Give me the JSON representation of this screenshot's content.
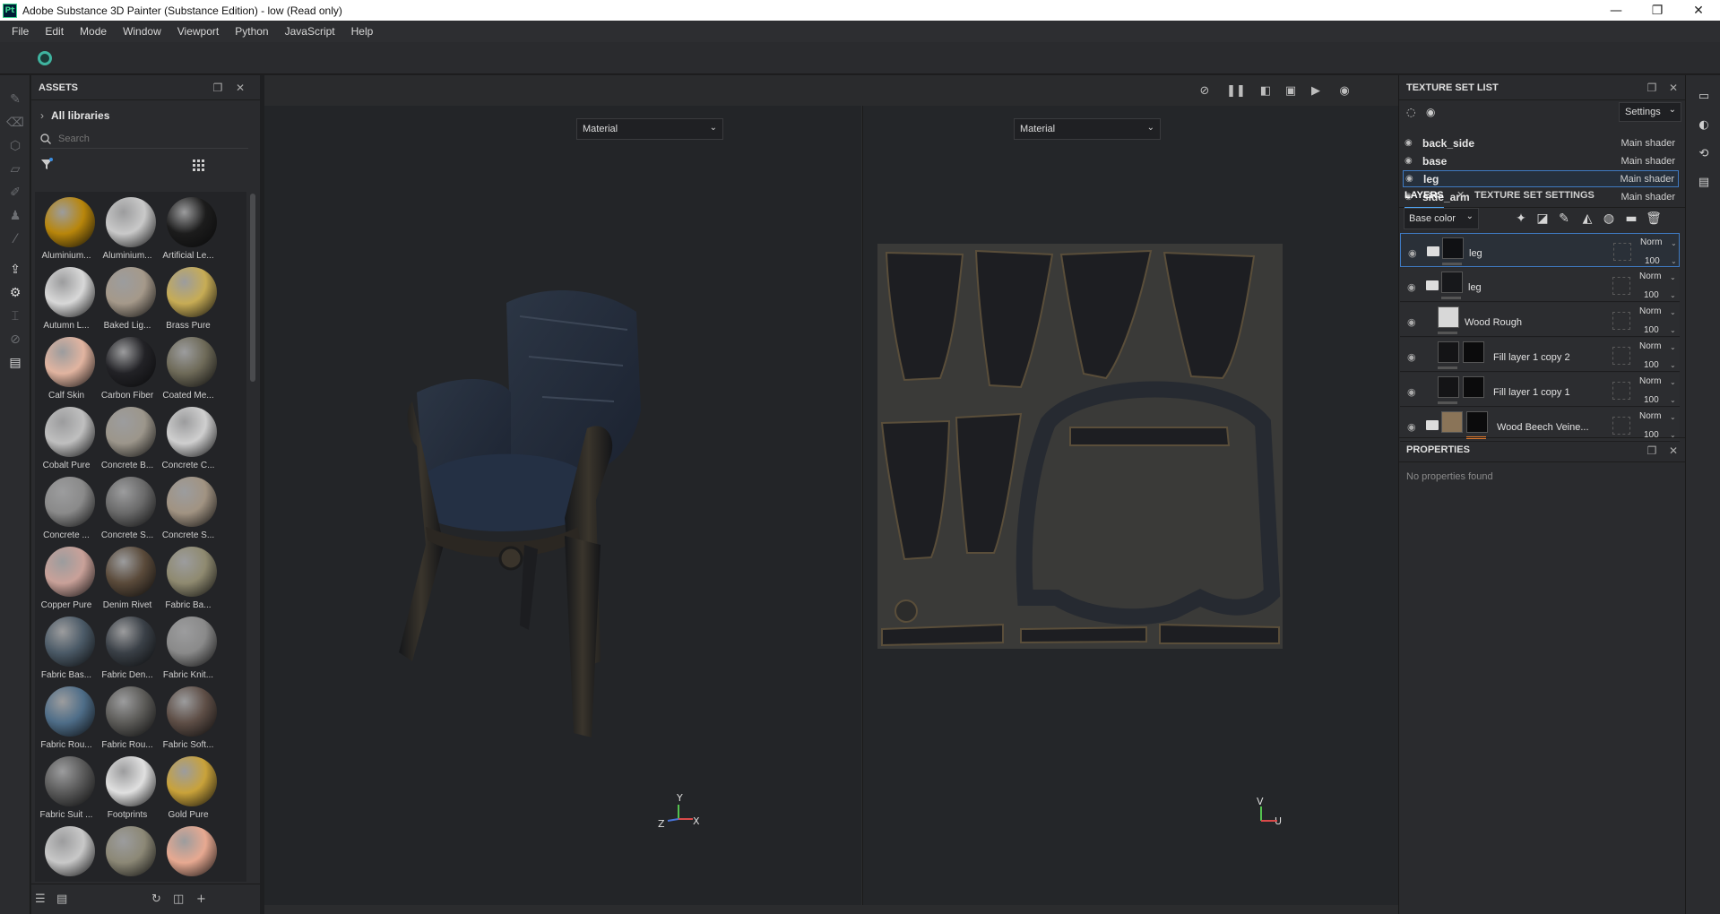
{
  "window": {
    "title": "Adobe Substance 3D Painter (Substance Edition) - low (Read only)",
    "app_badge": "Pt",
    "controls": [
      "—",
      "❐",
      "✕"
    ]
  },
  "menu": [
    "File",
    "Edit",
    "Mode",
    "Window",
    "Viewport",
    "Python",
    "JavaScript",
    "Help"
  ],
  "assets": {
    "title": "ASSETS",
    "libraries_label": "All libraries",
    "search_placeholder": "Search",
    "materials": [
      {
        "label": "Aluminium...",
        "color": "#b8860b"
      },
      {
        "label": "Aluminium...",
        "color": "#c9c9c9"
      },
      {
        "label": "Artificial Le...",
        "color": "#1c1c1c"
      },
      {
        "label": "Autumn L...",
        "color": "#d8d8d8"
      },
      {
        "label": "Baked Lig...",
        "color": "#a5998a"
      },
      {
        "label": "Brass Pure",
        "color": "#c7ac55"
      },
      {
        "label": "Calf Skin",
        "color": "#e1b4a0"
      },
      {
        "label": "Carbon Fiber",
        "color": "#222226"
      },
      {
        "label": "Coated Me...",
        "color": "#6e6a58"
      },
      {
        "label": "Cobalt Pure",
        "color": "#bfbfbf"
      },
      {
        "label": "Concrete B...",
        "color": "#9c968b"
      },
      {
        "label": "Concrete C...",
        "color": "#cfcfcf"
      },
      {
        "label": "Concrete ...",
        "color": "#8a8a8a"
      },
      {
        "label": "Concrete S...",
        "color": "#6a6a6a"
      },
      {
        "label": "Concrete S...",
        "color": "#a19382"
      },
      {
        "label": "Copper Pure",
        "color": "#c9a199"
      },
      {
        "label": "Denim Rivet",
        "color": "#5a4a3a"
      },
      {
        "label": "Fabric Ba...",
        "color": "#8f8a70"
      },
      {
        "label": "Fabric Bas...",
        "color": "#4b5a67"
      },
      {
        "label": "Fabric Den...",
        "color": "#3a4047"
      },
      {
        "label": "Fabric Knit...",
        "color": "#8a8a8a"
      },
      {
        "label": "Fabric Rou...",
        "color": "#4e6d88"
      },
      {
        "label": "Fabric Rou...",
        "color": "#5c5b58"
      },
      {
        "label": "Fabric Soft...",
        "color": "#5e4e46"
      },
      {
        "label": "Fabric Suit ...",
        "color": "#5a5a5a"
      },
      {
        "label": "Footprints",
        "color": "#e0e0e0"
      },
      {
        "label": "Gold Pure",
        "color": "#c9a23a"
      },
      {
        "label": "",
        "color": "#c8c8c8"
      },
      {
        "label": "",
        "color": "#8c8876"
      },
      {
        "label": "",
        "color": "#e7a991"
      }
    ]
  },
  "viewport": {
    "left_mode": "Material",
    "right_mode": "Material",
    "axes_3d": {
      "y": "Y",
      "z": "Z",
      "x": "X"
    },
    "axes_2d": {
      "v": "V",
      "u": "U"
    }
  },
  "texture_set_list": {
    "title": "TEXTURE SET LIST",
    "settings_label": "Settings",
    "items": [
      {
        "name": "back_side",
        "shader": "Main shader",
        "selected": false
      },
      {
        "name": "base",
        "shader": "Main shader",
        "selected": false
      },
      {
        "name": "leg",
        "shader": "Main shader",
        "selected": true
      },
      {
        "name": "side_arm",
        "shader": "Main shader",
        "selected": false
      }
    ]
  },
  "layers": {
    "tab_layers": "LAYERS",
    "tab_settings": "TEXTURE SET SETTINGS",
    "channel": "Base color",
    "items": [
      {
        "name": "leg",
        "blend": "Norm",
        "opacity": "100",
        "folder": true,
        "selected": true
      },
      {
        "name": "leg",
        "blend": "Norm",
        "opacity": "100",
        "folder": true,
        "selected": false
      },
      {
        "name": "Wood Rough",
        "blend": "Norm",
        "opacity": "100",
        "folder": false,
        "selected": false
      },
      {
        "name": "Fill layer 1 copy 2",
        "blend": "Norm",
        "opacity": "100",
        "folder": false,
        "selected": false
      },
      {
        "name": "Fill layer 1 copy 1",
        "blend": "Norm",
        "opacity": "100",
        "folder": false,
        "selected": false
      },
      {
        "name": "Wood Beech Veine...",
        "blend": "Norm",
        "opacity": "100",
        "folder": true,
        "selected": false
      }
    ]
  },
  "properties": {
    "title": "PROPERTIES",
    "empty_text": "No properties found"
  }
}
